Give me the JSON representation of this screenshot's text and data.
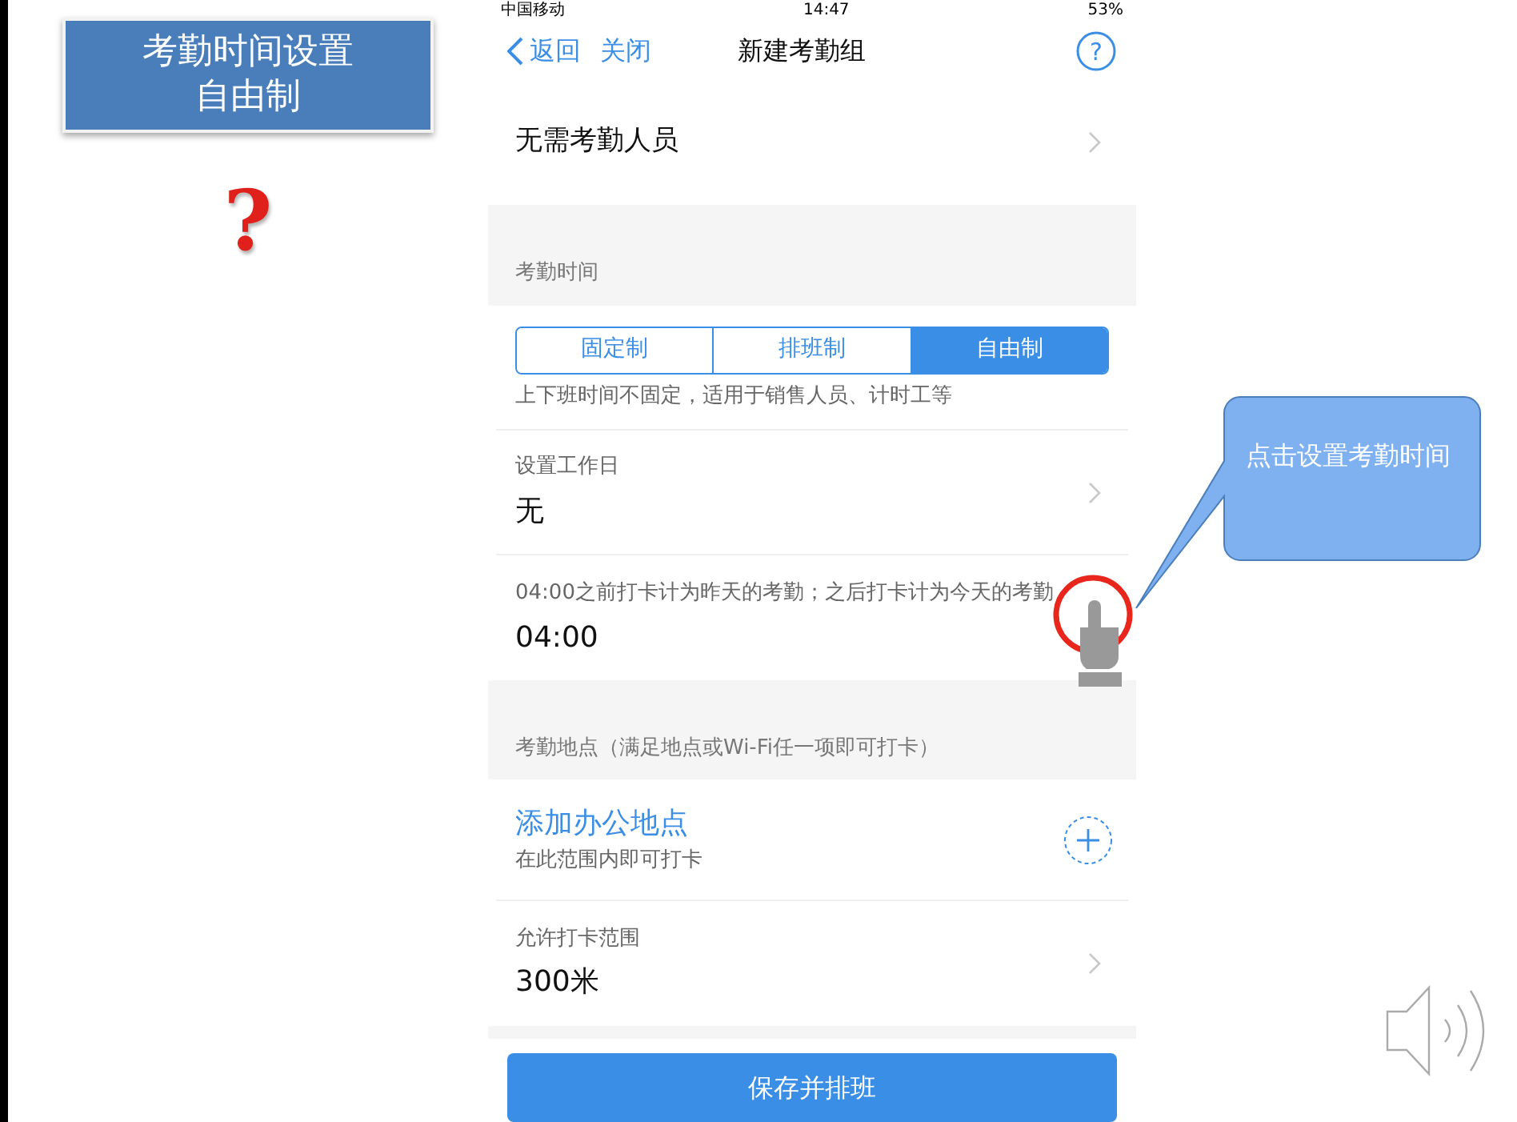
{
  "slide": {
    "title_lines": [
      "考勤时间设置",
      "自由制"
    ],
    "question_mark": "?"
  },
  "status_bar": {
    "carrier": "中国移动",
    "time": "14:47",
    "battery": "53%"
  },
  "nav": {
    "back": "返回",
    "close": "关闭",
    "title": "新建考勤组",
    "help": "?"
  },
  "exempt_row": {
    "label": "无需考勤人员"
  },
  "time_section": {
    "header": "考勤时间",
    "segments": [
      {
        "label": "固定制",
        "selected": false
      },
      {
        "label": "排班制",
        "selected": false
      },
      {
        "label": "自由制",
        "selected": true
      }
    ],
    "description": "上下班时间不固定，适用于销售人员、计时工等",
    "rows": [
      {
        "label": "设置工作日",
        "value": "无"
      },
      {
        "label": "04:00之前打卡计为昨天的考勤；之后打卡计为今天的考勤",
        "value": "04:00"
      }
    ]
  },
  "location_section": {
    "header": "考勤地点（满足地点或Wi-Fi任一项即可打卡）",
    "add_location": {
      "title": "添加办公地点",
      "subtitle": "在此范围内即可打卡"
    },
    "range_row": {
      "label": "允许打卡范围",
      "value": "300米"
    }
  },
  "save_button": "保存并排班",
  "callout": {
    "text": "点击设置考勤时间"
  }
}
